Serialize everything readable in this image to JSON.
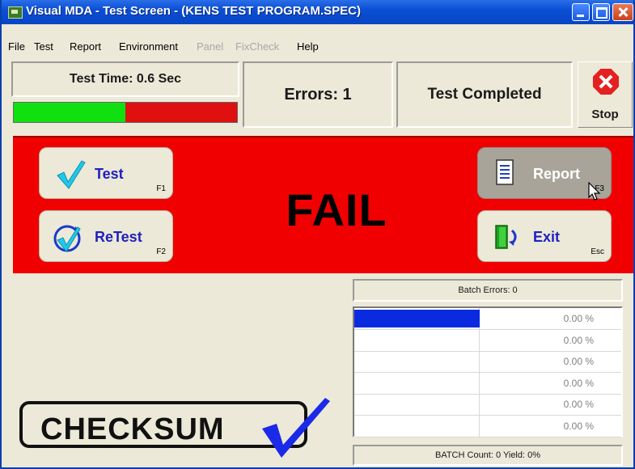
{
  "window": {
    "title": "Visual MDA - Test Screen - (KENS TEST PROGRAM.SPEC)"
  },
  "menu": [
    {
      "label": "File",
      "enabled": true
    },
    {
      "label": "Test",
      "enabled": true
    },
    {
      "label": "Report",
      "enabled": true
    },
    {
      "label": "Environment",
      "enabled": true
    },
    {
      "label": "Panel",
      "enabled": false
    },
    {
      "label": "FixCheck",
      "enabled": false
    },
    {
      "label": "Help",
      "enabled": true
    }
  ],
  "status": {
    "test_time": "Test Time: 0.6 Sec",
    "progress_pass_fraction": 0.5,
    "errors": "Errors: 1",
    "state": "Test Completed",
    "stop_label": "Stop"
  },
  "result": {
    "text": "FAIL",
    "buttons": {
      "test": {
        "label": "Test",
        "key": "F1"
      },
      "retest": {
        "label": "ReTest",
        "key": "F2"
      },
      "report": {
        "label": "Report",
        "key": "F3"
      },
      "exit": {
        "label": "Exit",
        "key": "Esc"
      }
    }
  },
  "batch": {
    "errors_label": "Batch Errors: 0",
    "rows": [
      {
        "bar_fraction": 1.0,
        "percent": "0.00 %"
      },
      {
        "bar_fraction": 0,
        "percent": "0.00 %"
      },
      {
        "bar_fraction": 0,
        "percent": "0.00 %"
      },
      {
        "bar_fraction": 0,
        "percent": "0.00 %"
      },
      {
        "bar_fraction": 0,
        "percent": "0.00 %"
      },
      {
        "bar_fraction": 0,
        "percent": "0.00 %"
      }
    ],
    "count_label": "BATCH Count: 0  Yield: 0%"
  },
  "logo": {
    "text": "CHECKSUM"
  },
  "colors": {
    "fail_red": "#f00000",
    "pass_green": "#10e010",
    "bar_blue": "#0a2ae0",
    "button_text": "#2020c0"
  }
}
